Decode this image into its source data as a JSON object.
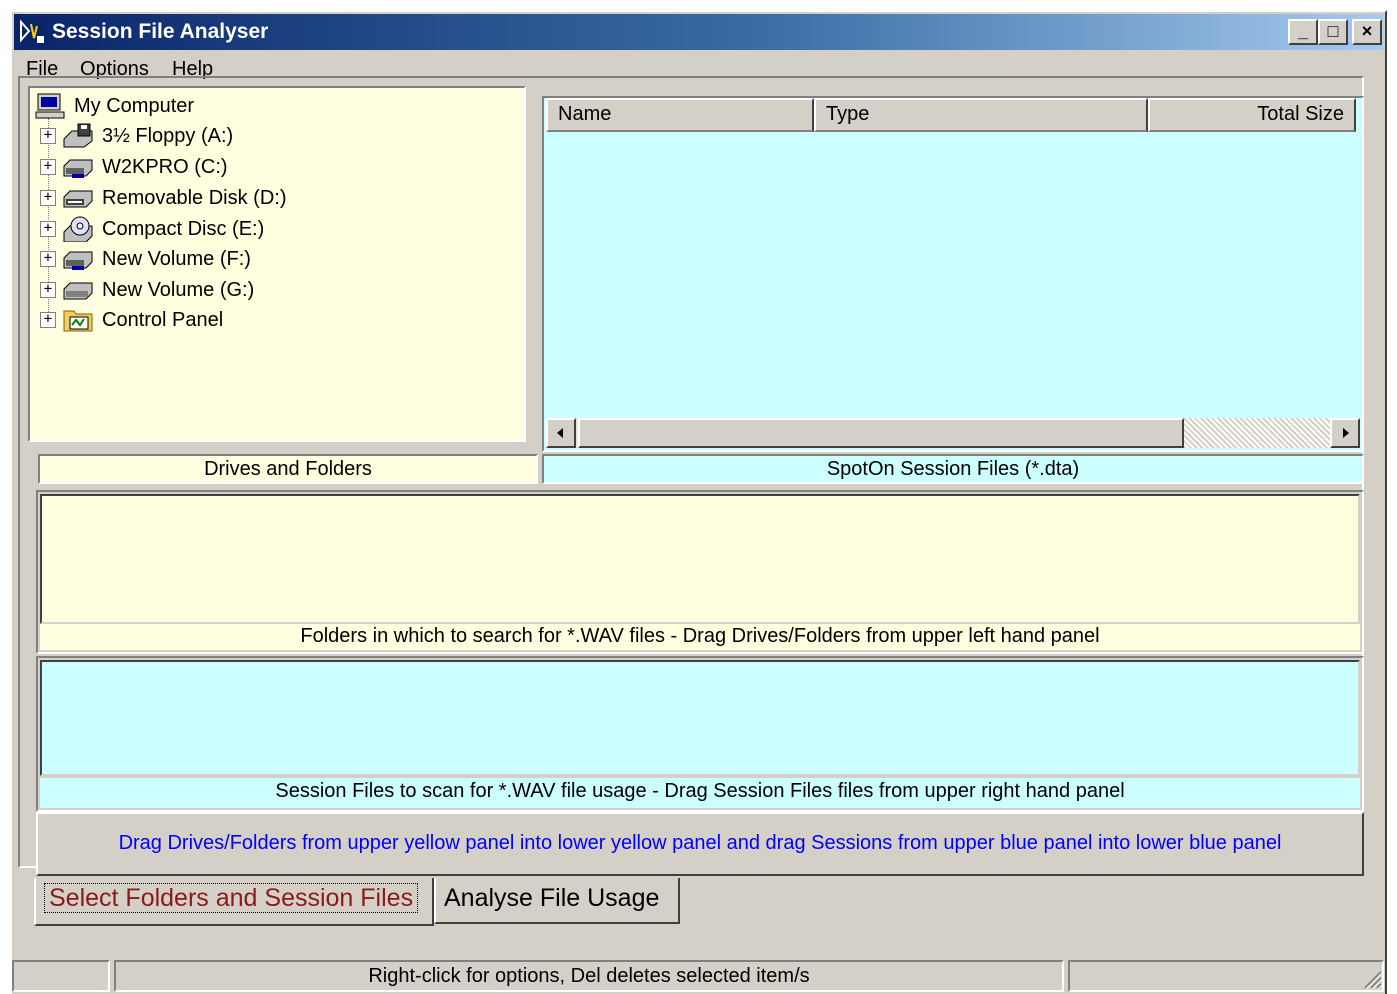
{
  "window": {
    "title": "Session File Analyser",
    "controls": {
      "minimize": "_",
      "maximize": "□",
      "close": "×"
    }
  },
  "menu": {
    "items": [
      {
        "label": "File",
        "accel": "F",
        "rest": "ile"
      },
      {
        "label": "Options",
        "accel": "O",
        "rest": "ptions"
      },
      {
        "label": "Help",
        "accel": "H",
        "rest": "elp"
      }
    ]
  },
  "tree": {
    "root": {
      "label": "My Computer",
      "icon": "computer-icon"
    },
    "items": [
      {
        "label": "3½ Floppy (A:)",
        "icon": "floppy-drive-icon"
      },
      {
        "label": "W2KPRO (C:)",
        "icon": "hard-drive-icon"
      },
      {
        "label": "Removable Disk (D:)",
        "icon": "removable-drive-icon"
      },
      {
        "label": "Compact Disc (E:)",
        "icon": "cd-drive-icon"
      },
      {
        "label": "New Volume (F:)",
        "icon": "hard-drive-icon"
      },
      {
        "label": "New Volume (G:)",
        "icon": "hard-drive-icon"
      },
      {
        "label": "Control Panel",
        "icon": "control-panel-icon"
      }
    ],
    "caption": "Drives and Folders"
  },
  "file_list": {
    "columns": [
      "Name",
      "Type",
      "Total Size"
    ],
    "caption": "SpotOn Session Files (*.dta)"
  },
  "folders_panel": {
    "caption": "Folders in which to search for *.WAV files - Drag Drives/Folders from upper left hand panel"
  },
  "sessions_panel": {
    "caption": "Session Files to scan for *.WAV file usage - Drag Session Files files from upper right hand panel"
  },
  "info_text": "Drag Drives/Folders from upper yellow panel into lower yellow panel and drag Sessions from upper blue panel into lower blue panel",
  "tabs": [
    {
      "label": "Select Folders and Session Files",
      "active": true
    },
    {
      "label": "Analyse File Usage",
      "active": false
    }
  ],
  "status": {
    "message": "Right-click for options, Del deletes selected item/s"
  },
  "colors": {
    "panel_yellow": "#ffffe0",
    "panel_blue": "#ccffff",
    "info_text": "#0000ff",
    "active_tab_text": "#8b1a1a"
  }
}
